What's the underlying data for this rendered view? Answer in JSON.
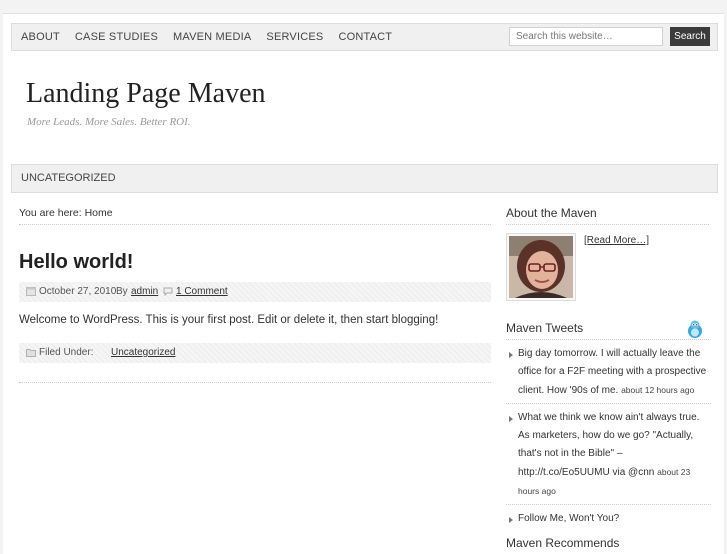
{
  "nav": {
    "items": [
      "ABOUT",
      "CASE STUDIES",
      "MAVEN MEDIA",
      "SERVICES",
      "CONTACT"
    ],
    "search_placeholder": "Search this website…",
    "search_button": "Search"
  },
  "header": {
    "title": "Landing Page Maven",
    "tagline": "More Leads. More Sales. Better ROI."
  },
  "subnav": {
    "item": "UNCATEGORIZED"
  },
  "breadcrumb": {
    "label": "You are here:",
    "current": "Home"
  },
  "post": {
    "title": "Hello world!",
    "date": "October 27, 2010",
    "by": "By",
    "author": "admin",
    "comments": "1 Comment",
    "body": "Welcome to WordPress. This is your first post. Edit or delete it, then start blogging!",
    "filed_label": "Filed Under:",
    "category": "Uncategorized"
  },
  "sidebar": {
    "about_title": "About the Maven",
    "read_more": "[Read More…]",
    "tweets_title": "Maven Tweets",
    "tweets": [
      {
        "text": "Big day tomorrow. I will actually leave the office for a F2F meeting with a prospective client. How '90s of me.",
        "time": "about 12 hours ago"
      },
      {
        "text": "What we think we know ain't always true. As marketers, how do we go? \"Actually, that's not in the Bible\" – http://t.co/Eo5UUMU via @cnn",
        "time": "about 23 hours ago"
      }
    ],
    "follow": "Follow Me, Won't You?",
    "recommends_title": "Maven Recommends"
  }
}
